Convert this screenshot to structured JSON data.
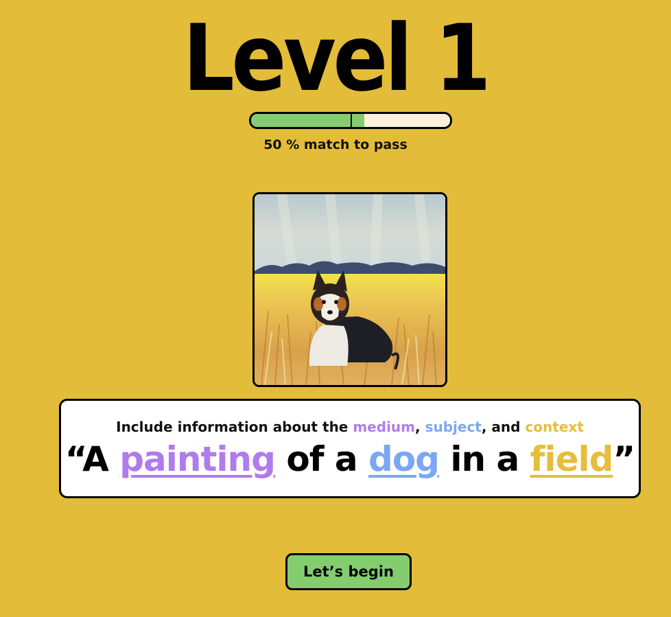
{
  "level": {
    "title": "Level 1"
  },
  "progress": {
    "pass_threshold": 0.5,
    "current_fill": 0.57,
    "pass_text": "50 % match to pass"
  },
  "painting": {
    "icon": "dog-painting-image"
  },
  "prompt_card": {
    "hint_prefix": "Include information about the ",
    "hint_medium": "medium",
    "hint_sep1": ", ",
    "hint_subject": "subject",
    "hint_sep2": ", and ",
    "hint_context": "context",
    "open_quote": "“A ",
    "medium_word": "painting",
    "mid1": " of a ",
    "subject_word": "dog",
    "mid2": " in a ",
    "context_word": "field",
    "close_quote": "”"
  },
  "button": {
    "label": "Let’s begin"
  },
  "colors": {
    "background": "#E3BD39",
    "progress_fill": "#83CD6F",
    "progress_track": "#FBF1DA",
    "medium": "#B07CEB",
    "subject": "#7DA7F2",
    "context": "#E6BD3C",
    "button": "#83CD6F"
  }
}
